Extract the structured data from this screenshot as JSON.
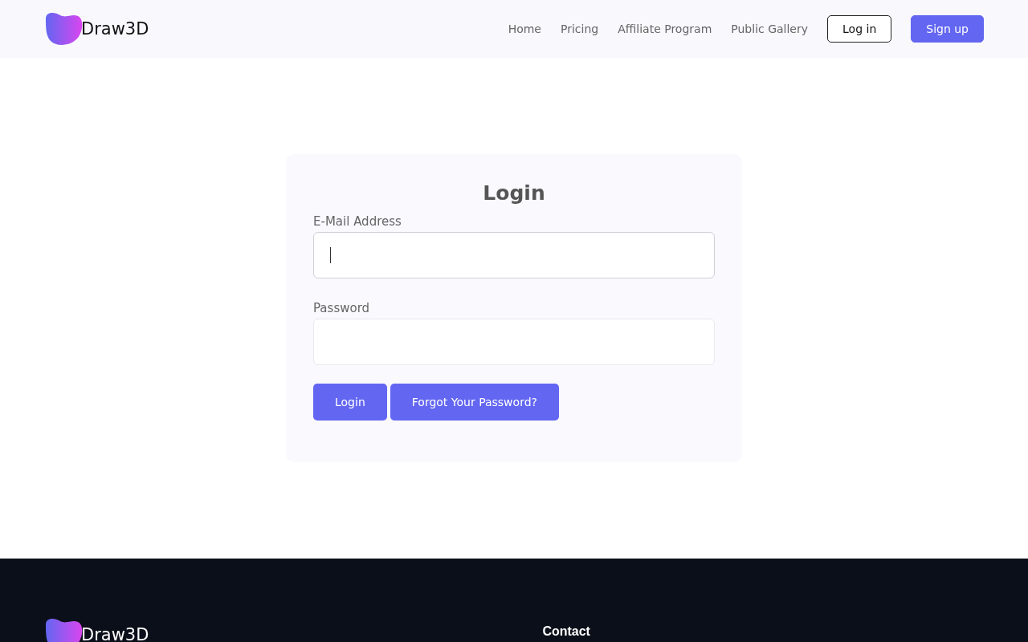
{
  "header": {
    "brand": "Draw3D",
    "nav": [
      "Home",
      "Pricing",
      "Affiliate Program",
      "Public Gallery"
    ],
    "buttons": [
      {
        "label": "Log in",
        "kind": "outline"
      },
      {
        "label": "Sign up",
        "kind": "filled"
      }
    ]
  },
  "login": {
    "title": "Login",
    "fields": [
      {
        "label": "E-Mail Address",
        "focused": true
      },
      {
        "label": "Password",
        "focused": false
      }
    ],
    "buttons": [
      "Login",
      "Forgot Your Password?"
    ]
  },
  "footer": {
    "brand": "Draw3D",
    "heading": "Contact"
  }
}
